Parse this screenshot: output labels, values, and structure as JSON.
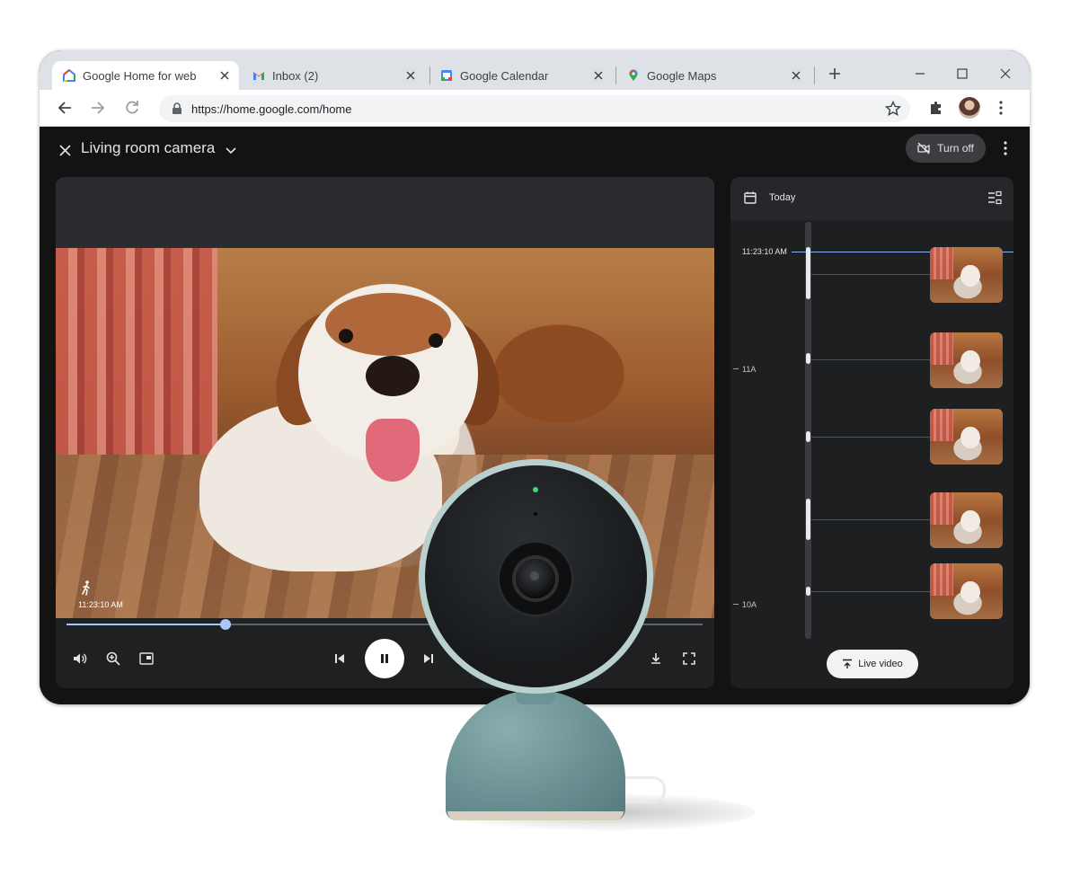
{
  "browser": {
    "tabs": [
      {
        "title": "Google Home for web",
        "icon": "google-home-icon",
        "active": true
      },
      {
        "title": "Inbox (2)",
        "icon": "gmail-icon",
        "active": false
      },
      {
        "title": "Google Calendar",
        "icon": "calendar-icon",
        "active": false
      },
      {
        "title": "Google Maps",
        "icon": "maps-icon",
        "active": false
      }
    ],
    "url": "https://home.google.com/home"
  },
  "header": {
    "camera_name": "Living room camera",
    "turn_off_label": "Turn off"
  },
  "player": {
    "timestamp": "11:23:10 AM",
    "progress": 0.25,
    "state": "playing"
  },
  "timeline": {
    "day_label": "Today",
    "current_time": "11:23:10 AM",
    "hour_labels": [
      "11A",
      "10A"
    ],
    "events": 5,
    "live_button_label": "Live video"
  },
  "colors": {
    "accent": "#a8c7fa",
    "led": "#4cd472",
    "camera_body": "#6a9093"
  }
}
